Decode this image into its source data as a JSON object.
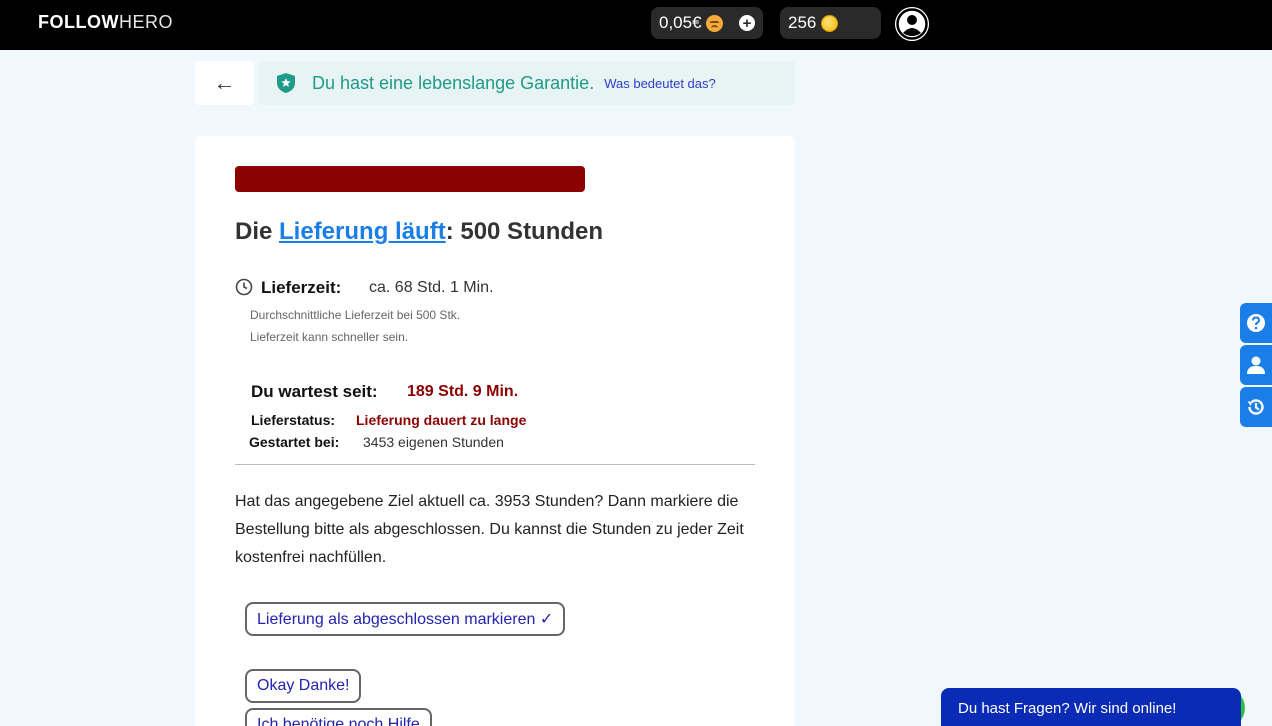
{
  "header": {
    "logo_bold": "FOLLOW",
    "logo_light": "HERO",
    "balance": "0,05€",
    "coins": "256"
  },
  "guarantee": {
    "back_arrow": "←",
    "text": "Du hast eine lebenslange Garantie.",
    "link": "Was bedeutet das?"
  },
  "order": {
    "title_prefix": "Die ",
    "title_link": "Lieferung läuft",
    "title_suffix": ": 500 Stunden",
    "delivery_time_label": "Lieferzeit:",
    "delivery_time_value": "ca. 68 Std. 1 Min.",
    "note_1": "Durchschnittliche Lieferzeit bei 500 Stk.",
    "note_2": "Lieferzeit kann schneller sein.",
    "waiting_label": "Du wartest seit:",
    "waiting_value": "189 Std. 9 Min.",
    "status_label": "Lieferstatus:",
    "status_value": "Lieferung dauert zu lange",
    "started_label": "Gestartet bei:",
    "started_value": "3453 eigenen Stunden",
    "paragraph": "Hat das angegebene Ziel aktuell ca. 3953 Stunden? Dann markiere die Bestellung bitte als abgeschlossen. Du kannst die Stunden zu jeder Zeit kostenfrei nachfüllen.",
    "btn_complete": "Lieferung als abgeschlossen markieren ✓",
    "btn_thanks": "Okay Danke!",
    "btn_help": "Ich benötige noch Hilfe"
  },
  "chat": {
    "text": "Du hast Fragen? Wir sind online!"
  },
  "colors": {
    "accent_blue": "#1a7ee8",
    "danger_red": "#8b0000",
    "guarantee_teal": "#1f9b8a",
    "chat_blue": "#0a2bb5"
  },
  "icons": {
    "balance_icon": "sad-face-icon",
    "add_icon": "plus-icon",
    "coin_icon": "coin-icon",
    "profile_icon": "user-avatar-icon",
    "shield_icon": "shield-star-icon",
    "clock_icon": "clock-icon",
    "side_1": "help-icon",
    "side_2": "user-icon",
    "side_3": "history-icon"
  }
}
